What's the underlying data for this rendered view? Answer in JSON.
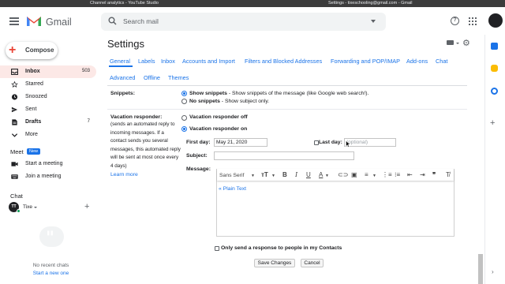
{
  "window": {
    "left_title": "Channel analytics - YouTube Studio",
    "right_title": "Settings - tixeschooling@gmail.com - Gmail"
  },
  "header": {
    "app_name": "Gmail",
    "search_placeholder": "Search mail",
    "icons": [
      "menu-icon",
      "gmail-logo",
      "search-icon",
      "search-options-icon",
      "help-icon",
      "apps-icon",
      "account-avatar"
    ]
  },
  "compose": {
    "label": "Compose"
  },
  "nav": {
    "items": [
      {
        "label": "Inbox",
        "count": "503",
        "icon": "inbox-icon",
        "bold": true
      },
      {
        "label": "Starred",
        "count": "",
        "icon": "star-icon",
        "bold": false
      },
      {
        "label": "Snoozed",
        "count": "",
        "icon": "clock-icon",
        "bold": false
      },
      {
        "label": "Sent",
        "count": "",
        "icon": "send-icon",
        "bold": false
      },
      {
        "label": "Drafts",
        "count": "7",
        "icon": "draft-icon",
        "bold": true
      },
      {
        "label": "More",
        "count": "",
        "icon": "chevron-down-icon",
        "bold": false
      }
    ]
  },
  "meet": {
    "title": "Meet",
    "badge": "New",
    "items": [
      {
        "label": "Start a meeting",
        "icon": "video-icon"
      },
      {
        "label": "Join a meeting",
        "icon": "keyboard-icon"
      }
    ]
  },
  "chat": {
    "title": "Chat",
    "user": "Tixe",
    "user_initials": "TT",
    "empty": "No recent chats",
    "start_link": "Start a new one"
  },
  "settings": {
    "title": "Settings",
    "tabs_row1": [
      "General",
      "Labels",
      "Inbox",
      "Accounts and Import",
      "Filters and Blocked Addresses",
      "Forwarding and POP/IMAP",
      "Add-ons",
      "Chat"
    ],
    "tabs_row2": [
      "Advanced",
      "Offline",
      "Themes"
    ],
    "active_tab": "General",
    "snippets": {
      "label": "Snippets:",
      "show_bold": "Show snippets",
      "show_rest": " - Show snippets of the message (like Google web search!).",
      "none_bold": "No snippets",
      "none_rest": " - Show subject only.",
      "selected": "show"
    },
    "vacation": {
      "label": "Vacation responder:",
      "description": [
        "(sends an automated reply to",
        "incoming messages. If a",
        "contact sends you several",
        "messages, this automated reply",
        "will be sent at most once every",
        "4 days)"
      ],
      "learn_more": "Learn more",
      "off_label": "Vacation responder off",
      "on_label": "Vacation responder on",
      "selected": "on",
      "first_day_label": "First day:",
      "first_day_value": "May 21, 2020",
      "last_day_label": "Last day:",
      "last_day_placeholder": "(optional)",
      "subject_label": "Subject:",
      "subject_value": "",
      "message_label": "Message:",
      "font_name": "Sans Serif",
      "plain_text_link": "« Plain Text",
      "contacts_only": "Only send a response to people in my Contacts"
    },
    "buttons": {
      "save": "Save Changes",
      "cancel": "Cancel"
    }
  },
  "colors": {
    "accent": "#1a73e8",
    "inbox_active_bg": "#fce8e6",
    "brand_red": "#ea4335",
    "online": "#0f9d58"
  }
}
